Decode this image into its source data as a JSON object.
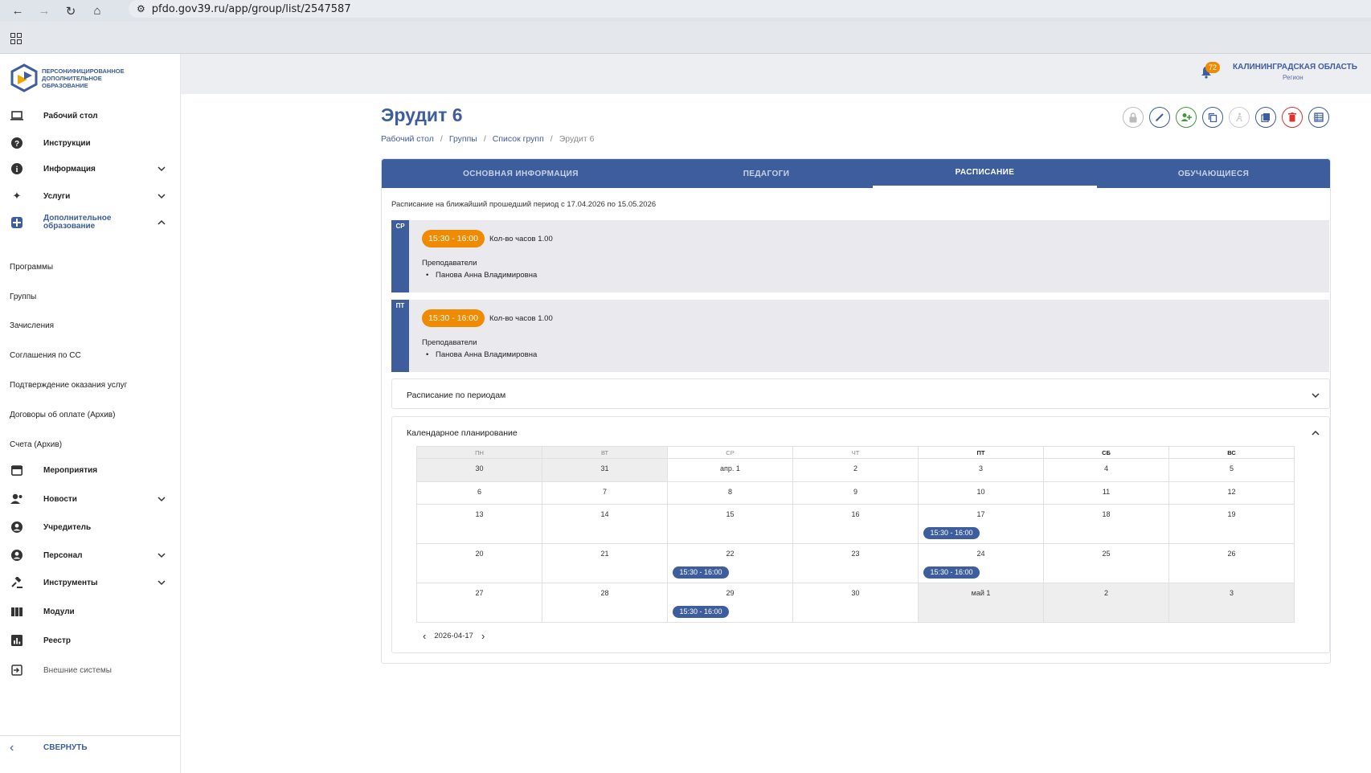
{
  "browser": {
    "url": "pfdo.gov39.ru/app/group/list/2547587"
  },
  "logo": {
    "text": "ПЕРСОНИФИЦИРОВАННОЕ ДОПОЛНИТЕЛЬНОЕ ОБРАЗОВАНИЕ"
  },
  "sidebar": {
    "items": [
      {
        "label": "Рабочий стол",
        "icon": "laptop-icon"
      },
      {
        "label": "Инструкции",
        "icon": "help-icon"
      },
      {
        "label": "Информация",
        "icon": "info-icon"
      },
      {
        "label": "Услуги",
        "icon": "sparkle-icon"
      },
      {
        "label": "Дополнительное образование",
        "icon": "plus-box-icon"
      }
    ],
    "sub_items": [
      "Программы",
      "Группы",
      "Зачисления",
      "Соглашения по СС",
      "Подтверждение оказания услуг",
      "Договоры об оплате (Архив)",
      "Счета (Архив)"
    ],
    "items2": [
      {
        "label": "Мероприятия",
        "icon": "calendar-icon"
      },
      {
        "label": "Новости",
        "icon": "people-icon"
      },
      {
        "label": "Учредитель",
        "icon": "person-icon"
      },
      {
        "label": "Персонал",
        "icon": "person-icon"
      },
      {
        "label": "Инструменты",
        "icon": "gavel-icon"
      },
      {
        "label": "Модули",
        "icon": "modules-icon"
      },
      {
        "label": "Реестр",
        "icon": "chart-icon"
      },
      {
        "label": "Внешние системы",
        "icon": "login-icon"
      }
    ],
    "collapse_label": "СВЕРНУТЬ"
  },
  "header": {
    "notifications": "72",
    "region_name": "КАЛИНИНГРАДСКАЯ ОБЛАСТЬ",
    "region_sub": "Регион"
  },
  "page": {
    "title": "Эрудит 6",
    "breadcrumb": [
      "Рабочий стол",
      "Группы",
      "Список групп",
      "Эрудит 6"
    ]
  },
  "tabs": [
    "ОСНОВНАЯ ИНФОРМАЦИЯ",
    "ПЕДАГОГИ",
    "РАСПИСАНИЕ",
    "ОБУЧАЮЩИЕСЯ"
  ],
  "schedule": {
    "period_text": "Расписание на ближайший прошедший период с 17.04.2026 по 15.05.2026",
    "days": [
      {
        "day": "СР",
        "time": "15:30 - 16:00",
        "hours": "Кол-во часов 1.00",
        "teachers_label": "Преподаватели",
        "teacher": "Панова Анна Владимировна"
      },
      {
        "day": "ПТ",
        "time": "15:30 - 16:00",
        "hours": "Кол-во часов 1.00",
        "teachers_label": "Преподаватели",
        "teacher": "Панова Анна Владимировна"
      }
    ]
  },
  "accordions": {
    "periods": "Расписание по периодам",
    "calendar": "Календарное планирование"
  },
  "calendar": {
    "weekdays": [
      "пн",
      "вт",
      "ср",
      "чт",
      "пт",
      "сб",
      "вс"
    ],
    "rows": [
      [
        "30",
        "31",
        "апр. 1",
        "2",
        "3",
        "4",
        "5"
      ],
      [
        "6",
        "7",
        "8",
        "9",
        "10",
        "11",
        "12"
      ],
      [
        "13",
        "14",
        "15",
        "16",
        "17",
        "18",
        "19"
      ],
      [
        "20",
        "21",
        "22",
        "23",
        "24",
        "25",
        "26"
      ],
      [
        "27",
        "28",
        "29",
        "30",
        "май 1",
        "2",
        "3"
      ]
    ],
    "event_label": "15:30 - 16:00",
    "current_date": "2026-04-17"
  }
}
